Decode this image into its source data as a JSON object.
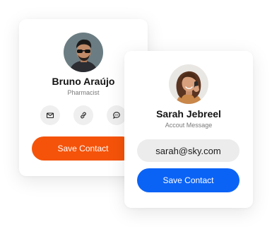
{
  "colors": {
    "orange_accent": "#f55309",
    "blue_accent": "#0b63f6",
    "chip_gray": "#efefef"
  },
  "card_left": {
    "name": "Bruno Araújo",
    "role": "Pharmacist",
    "icons": [
      "mail-icon",
      "link-icon",
      "chat-icon"
    ],
    "button_label": "Save Contact"
  },
  "card_right": {
    "name": "Sarah Jebreel",
    "role": "Accout Message",
    "email": "sarah@sky.com",
    "button_label": "Save Contact"
  }
}
